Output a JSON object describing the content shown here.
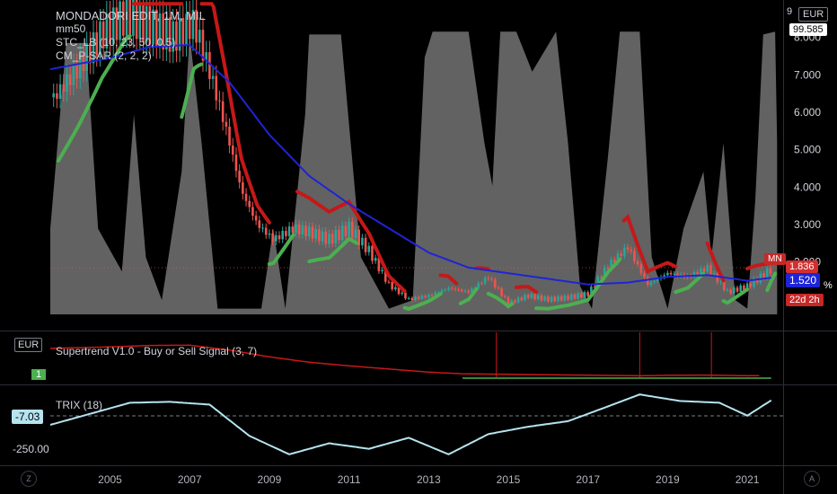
{
  "legend": {
    "title": "MONDADORI EDIT, 1M, MIL",
    "ma": "mm50",
    "stc": "STC_LB (10, 23, 50, 0.5)",
    "sar": "CM_P-SAR (2, 2, 2)"
  },
  "axis": {
    "currency": "EUR",
    "price_box": "99.585",
    "price_ticks": [
      "8.000",
      "7.000",
      "6.000",
      "5.000",
      "4.000",
      "3.000",
      "2.000"
    ],
    "tag_red": "1.836",
    "tag_mn": "MN",
    "tag_blue": "1.520",
    "tag_countdown": "22d 2h",
    "pct": "%",
    "nine": "9"
  },
  "supertrend": {
    "label": "Supertrend V1.0 - Buy or Sell Signal (3, 7)",
    "currency": "EUR",
    "signal": "1"
  },
  "trix": {
    "label": "TRIX (18)",
    "value": "-7.03",
    "tick": "-250.00"
  },
  "time_axis": [
    "2005",
    "2007",
    "2009",
    "2011",
    "2013",
    "2015",
    "2017",
    "2019",
    "2021"
  ],
  "bottom": {
    "z": "Z",
    "a": "A"
  },
  "colors": {
    "up": "#26a69a",
    "down": "#ef5350",
    "ma": "#1f24d6",
    "sar_red": "#c61818",
    "sar_green": "#4caf50",
    "stc": "#b2b2b2",
    "trix": "#b5e3ee"
  },
  "chart_data": {
    "type": "line",
    "price_ylim": [
      0.6,
      9.0
    ],
    "ma50": {
      "x": [
        2003.5,
        2005,
        2006,
        2007,
        2008,
        2009,
        2010,
        2011,
        2012,
        2013,
        2014,
        2015,
        2016,
        2017,
        2018,
        2019,
        2020,
        2021,
        2021.6
      ],
      "y": [
        7.15,
        7.45,
        7.75,
        7.8,
        6.8,
        5.4,
        4.3,
        3.55,
        2.9,
        2.25,
        1.85,
        1.7,
        1.55,
        1.4,
        1.45,
        1.6,
        1.65,
        1.5,
        1.58
      ]
    },
    "price_close": {
      "x": [
        2003.6,
        2004.2,
        2004.8,
        2005.4,
        2006,
        2006.6,
        2007.1,
        2007.5,
        2007.9,
        2008.3,
        2008.7,
        2009.1,
        2009.6,
        2010,
        2010.5,
        2011,
        2011.5,
        2012,
        2012.5,
        2013,
        2013.5,
        2014,
        2014.5,
        2015,
        2015.5,
        2016,
        2016.5,
        2017,
        2017.5,
        2018,
        2018.5,
        2019,
        2019.5,
        2020,
        2020.5,
        2021,
        2021.6
      ],
      "y": [
        6.4,
        7.2,
        8.1,
        8.6,
        8.3,
        8.0,
        8.4,
        7.1,
        5.6,
        3.9,
        3.0,
        2.6,
        2.9,
        2.8,
        2.6,
        2.9,
        2.3,
        1.4,
        1.0,
        1.1,
        1.3,
        1.2,
        1.6,
        0.9,
        1.1,
        1.0,
        1.05,
        1.15,
        1.9,
        2.4,
        1.4,
        1.7,
        1.6,
        1.85,
        1.2,
        1.35,
        1.8
      ]
    },
    "trix_ylim": [
      -330,
      60
    ],
    "trix_series": {
      "x": [
        2003.5,
        2004.5,
        2005.5,
        2006.5,
        2007.5,
        2008.5,
        2009.5,
        2010.5,
        2011.5,
        2012.5,
        2013.5,
        2014.5,
        2015.5,
        2016.5,
        2017.5,
        2018.3,
        2019.3,
        2020.3,
        2021,
        2021.6
      ],
      "y": [
        -140,
        -80,
        -20,
        -15,
        -30,
        -200,
        -300,
        -240,
        -270,
        -210,
        -300,
        -190,
        -150,
        -120,
        -40,
        25,
        -10,
        -20,
        -90,
        -7
      ]
    }
  }
}
